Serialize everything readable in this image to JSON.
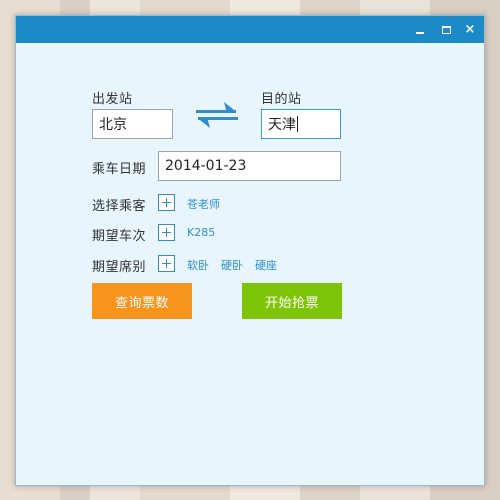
{
  "window": {
    "controls": {
      "minimize": "minimize",
      "maximize": "maximize",
      "close": "×"
    }
  },
  "form": {
    "from_label": "出发站",
    "from_value": "北京",
    "to_label": "目的站",
    "to_value": "天津",
    "date_label": "乘车日期",
    "date_value": "2014-01-23",
    "passenger_label": "选择乘客",
    "passengers": [
      "苍老师"
    ],
    "train_label": "期望车次",
    "trains": [
      "K285"
    ],
    "seat_label": "期望席别",
    "seats": [
      "软卧",
      "硬卧",
      "硬座"
    ]
  },
  "buttons": {
    "query": "查询票数",
    "start": "开始抢票"
  },
  "colors": {
    "titlebar": "#1b8ac6",
    "accent_blue": "#2e8ecf",
    "query_button": "#f7941d",
    "start_button": "#7ec50a",
    "window_bg": "#e8f5fd"
  },
  "icons": {
    "swap": "swap-arrows-icon",
    "add": "plus-icon"
  }
}
